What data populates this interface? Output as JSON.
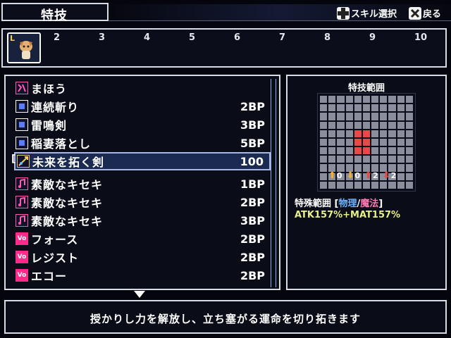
{
  "header": {
    "title": "特技",
    "hints": [
      {
        "icon": "dpad-icon",
        "label": "スキル選択"
      },
      {
        "icon": "x-button-icon",
        "label": "戻る"
      }
    ]
  },
  "slots": {
    "current_marker": "L",
    "numbers": [
      "2",
      "3",
      "4",
      "5",
      "6",
      "7",
      "8",
      "9",
      "10"
    ]
  },
  "skills": [
    {
      "name": "まほう",
      "cost": "",
      "icon": "magic-menu-icon",
      "icon_color": "#ff5ab0"
    },
    {
      "name": "連続斬り",
      "cost": "2BP",
      "icon": "sword-skill-icon",
      "icon_color": "#5a7cff"
    },
    {
      "name": "雷鳴剣",
      "cost": "3BP",
      "icon": "sword-skill-icon",
      "icon_color": "#5a7cff"
    },
    {
      "name": "稲妻落とし",
      "cost": "5BP",
      "icon": "sword-skill-icon",
      "icon_color": "#5a7cff"
    },
    {
      "name": "未来を拓く剣",
      "cost": "100",
      "icon": "future-sword-icon",
      "icon_color": "#c0a040",
      "selected": true
    },
    {
      "name": "素敵なキセキ",
      "cost": "1BP",
      "icon": "miracle-note-icon",
      "icon_color": "#ff5ab0"
    },
    {
      "name": "素敵なキセキ",
      "cost": "2BP",
      "icon": "miracle-note-icon",
      "icon_color": "#ff5ab0"
    },
    {
      "name": "素敵なキセキ",
      "cost": "3BP",
      "icon": "miracle-note-icon",
      "icon_color": "#ff5ab0"
    },
    {
      "name": "フォース",
      "cost": "2BP",
      "icon": "vo-icon",
      "icon_color": "#ff2a8a"
    },
    {
      "name": "レジスト",
      "cost": "2BP",
      "icon": "vo-icon",
      "icon_color": "#ff2a8a"
    },
    {
      "name": "エコー",
      "cost": "2BP",
      "icon": "vo-icon",
      "icon_color": "#ff2a8a"
    }
  ],
  "range": {
    "title": "特技範囲",
    "grid_size": 11,
    "hit_cells": [
      [
        4,
        5
      ],
      [
        5,
        5
      ],
      [
        4,
        6
      ],
      [
        5,
        6
      ],
      [
        4,
        4
      ],
      [
        5,
        4
      ]
    ],
    "arrows": [
      {
        "dir": "up",
        "value": "0"
      },
      {
        "dir": "down",
        "value": "0"
      },
      {
        "dir": "up",
        "value": "2"
      },
      {
        "dir": "down",
        "value": "2"
      }
    ],
    "type_label": "特殊範囲",
    "bracket_open": "[",
    "physical": "物理",
    "slash": "/",
    "magical": "魔法",
    "bracket_close": "]",
    "formula": "ATK157%+MAT157%"
  },
  "description": "授かりし力を解放し、立ち塞がる運命を切り拓きます",
  "colors": {
    "hit": "#e84848",
    "physical": "#6fb6ff",
    "magical": "#ff7ab0",
    "formula": "#e8ef8a"
  }
}
